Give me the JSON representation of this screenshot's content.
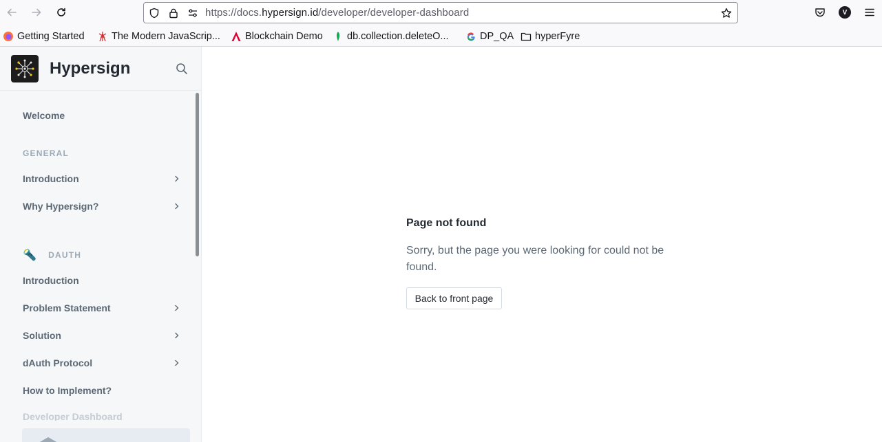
{
  "browser": {
    "url_prefix": "https://docs.",
    "url_host": "hypersign.id",
    "url_path": "/developer/developer-dashboard",
    "account_initial": "V",
    "bookmarks": [
      {
        "label": "Getting Started",
        "icon": "firefox-icon"
      },
      {
        "label": "The Modern JavaScrip...",
        "icon": "tower-icon"
      },
      {
        "label": "Blockchain Demo",
        "icon": "angular-icon"
      },
      {
        "label": "db.collection.deleteO...",
        "icon": "mongodb-leaf-icon"
      },
      {
        "label": "DP_QA",
        "icon": "google-icon"
      },
      {
        "label": "hyperFyre",
        "icon": "folder-icon"
      }
    ]
  },
  "sidebar": {
    "brand": "Hypersign",
    "welcome": "Welcome",
    "general_section": "GENERAL",
    "general_items": [
      {
        "label": "Introduction"
      },
      {
        "label": "Why Hypersign?"
      }
    ],
    "dauth_emoji": "🔦",
    "dauth_section": "DAUTH",
    "dauth_items": [
      {
        "label": "Introduction"
      },
      {
        "label": "Problem Statement"
      },
      {
        "label": "Solution"
      },
      {
        "label": "dAuth Protocol"
      },
      {
        "label": "How to Implement?"
      }
    ],
    "partial_item": "Developer Dashboard"
  },
  "main": {
    "title": "Page not found",
    "message": "Sorry, but the page you were looking for could not be found.",
    "back_button": "Back to front page"
  },
  "colors": {
    "accent": "#242a31",
    "muted": "#5c6975",
    "sidebar_bg": "#f5f7f9"
  }
}
